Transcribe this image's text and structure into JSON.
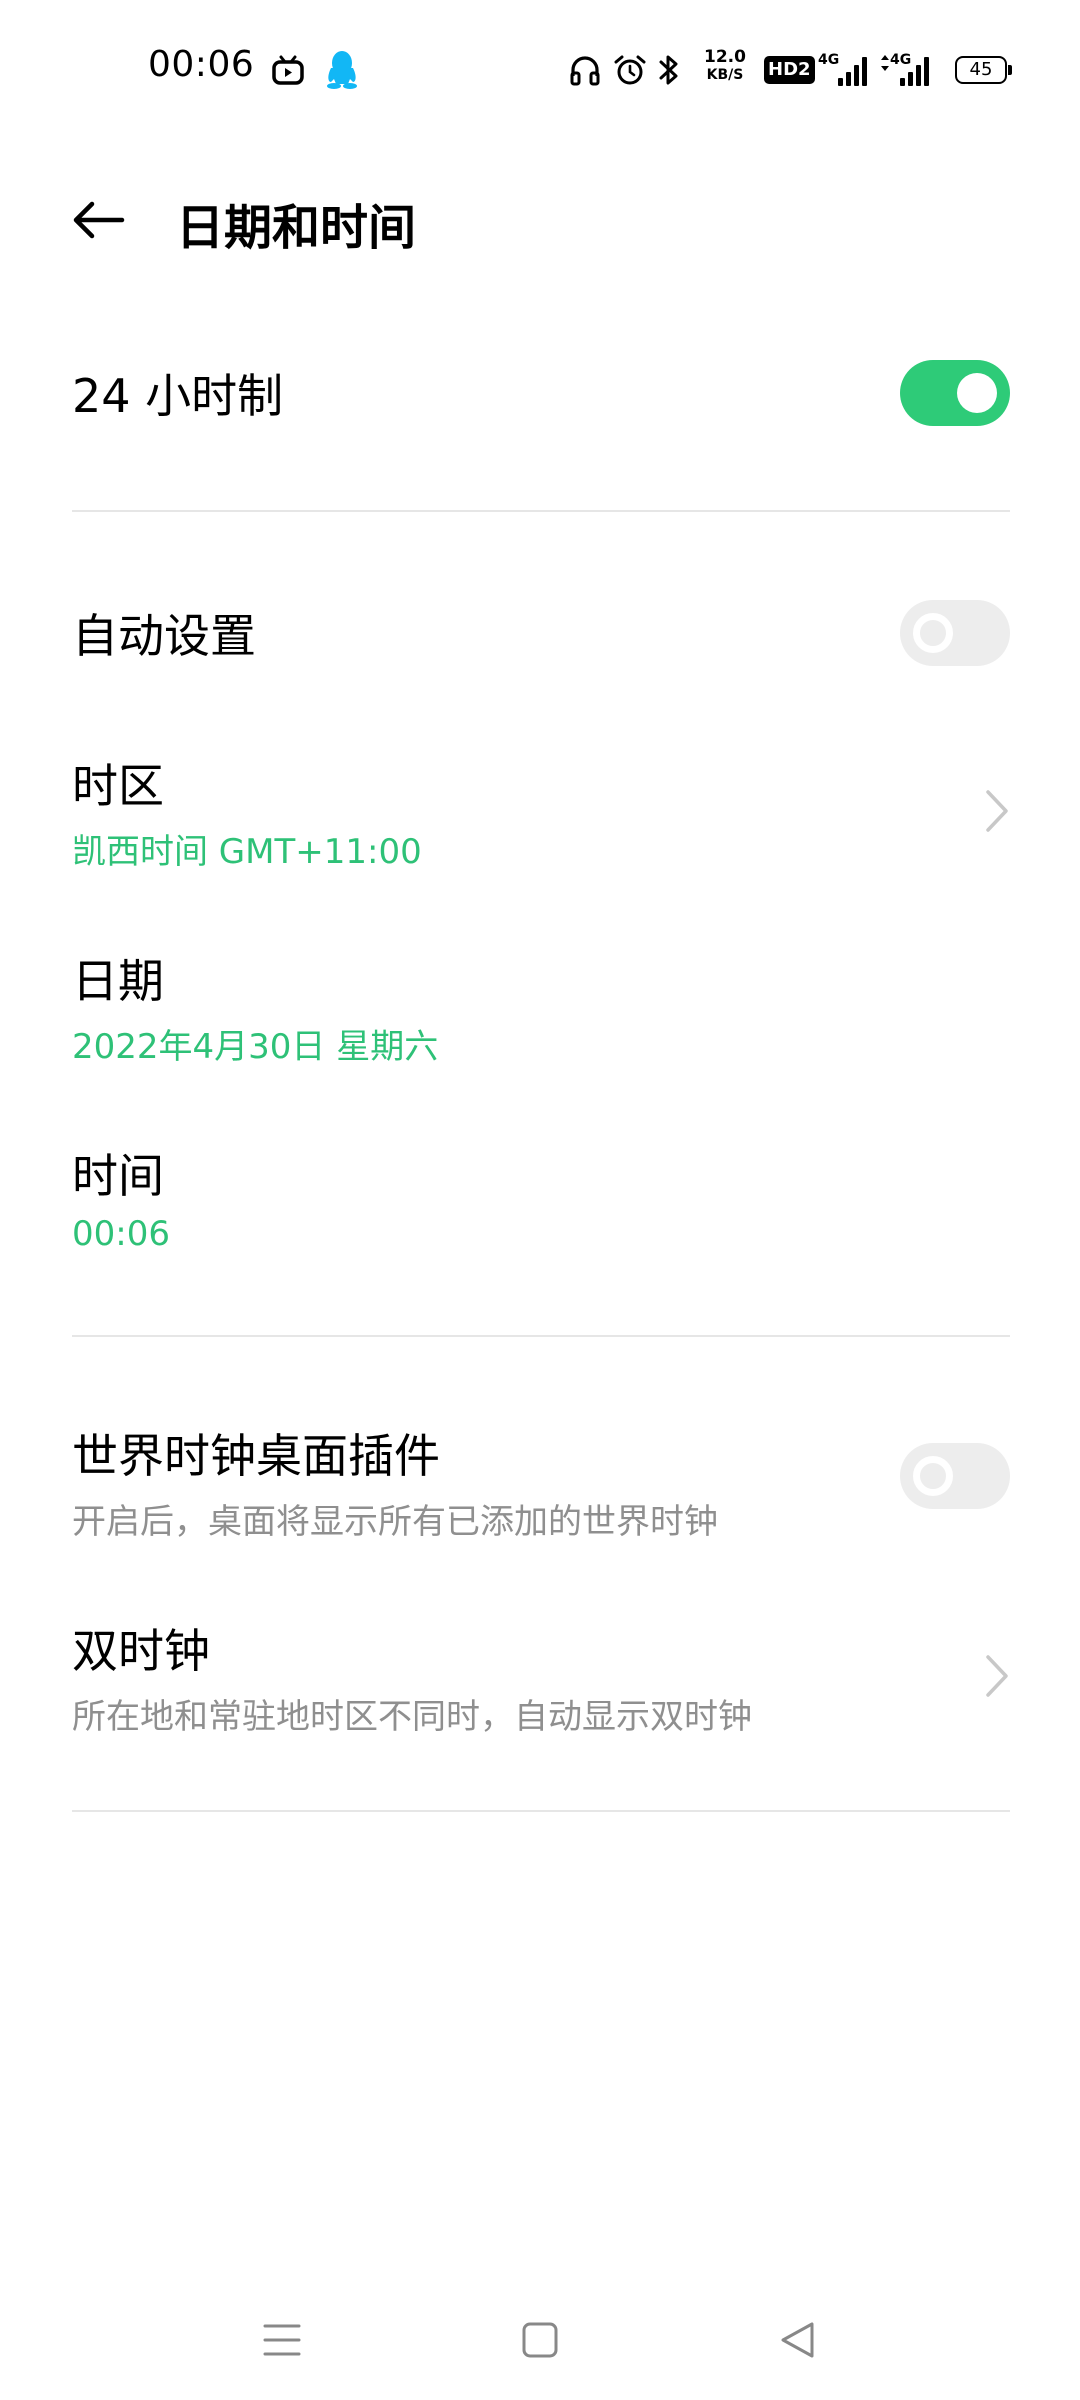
{
  "status_bar": {
    "time": "00:06",
    "net_speed_value": "12.0",
    "net_speed_unit": "KB/S",
    "hd_label": "HD2",
    "signal1_label": "4G",
    "signal2_label": "4G",
    "battery_level": "45",
    "icons": [
      "bilibili-icon",
      "qq-penguin-icon",
      "headphones-icon",
      "alarm-clock-icon",
      "bluetooth-icon"
    ]
  },
  "header": {
    "title": "日期和时间",
    "back_icon": "arrow-left-icon"
  },
  "settings": {
    "hour24": {
      "label": "24 小时制",
      "enabled": true
    },
    "auto_set": {
      "label": "自动设置",
      "enabled": false
    },
    "timezone": {
      "label": "时区",
      "value": "凯西时间 GMT+11:00"
    },
    "date": {
      "label": "日期",
      "value": "2022年4月30日 星期六"
    },
    "time": {
      "label": "时间",
      "value": "00:06"
    },
    "world_clock_widget": {
      "label": "世界时钟桌面插件",
      "description": "开启后，桌面将显示所有已添加的世界时钟",
      "enabled": false
    },
    "dual_clock": {
      "label": "双时钟",
      "description": "所在地和常驻地时区不同时，自动显示双时钟"
    }
  },
  "nav_bar": {
    "icons": [
      "menu-icon",
      "home-icon",
      "back-triangle-icon"
    ]
  },
  "colors": {
    "accent": "#2ecb78",
    "accent_text": "#2ec177",
    "secondary_text": "#8f8f8f",
    "divider": "#e6e6e6"
  }
}
